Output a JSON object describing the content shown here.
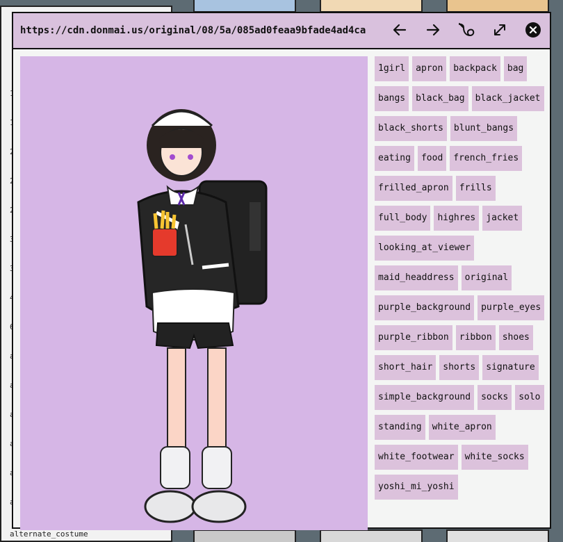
{
  "background": {
    "left_marks": [
      "1",
      "1",
      "2",
      "2",
      "2",
      "3",
      "3",
      "4",
      "6",
      "a",
      "a",
      "a",
      "a",
      "a",
      "a"
    ],
    "footer_text": "alternate_costume"
  },
  "viewer": {
    "url": "https://cdn.donmai.us/original/08/5a/085ad0feaa9bfade4ad4ca",
    "buttons": {
      "prev_icon": "arrow-left",
      "next_icon": "arrow-right",
      "source_icon": "branch-link",
      "expand_icon": "expand-diagonal",
      "close_icon": "close-circle"
    },
    "image": {
      "background_color": "#d6b6e6",
      "alt": "girl"
    },
    "tags": [
      "1girl",
      "apron",
      "backpack",
      "bag",
      "bangs",
      "black_bag",
      "black_jacket",
      "black_shorts",
      "blunt_bangs",
      "eating",
      "food",
      "french_fries",
      "frilled_apron",
      "frills",
      "full_body",
      "highres",
      "jacket",
      "looking_at_viewer",
      "maid_headdress",
      "original",
      "purple_background",
      "purple_eyes",
      "purple_ribbon",
      "ribbon",
      "shoes",
      "short_hair",
      "shorts",
      "signature",
      "simple_background",
      "socks",
      "solo",
      "standing",
      "white_apron",
      "white_footwear",
      "white_socks",
      "yoshi_mi_yoshi"
    ]
  }
}
